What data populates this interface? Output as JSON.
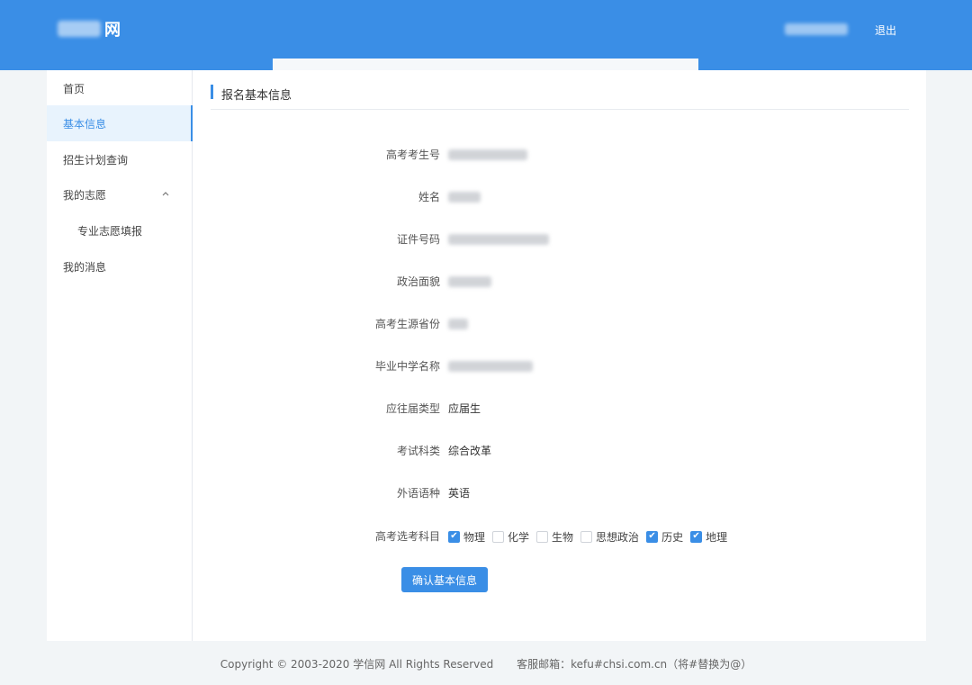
{
  "header": {
    "logo_text": "网",
    "logout_label": "退出"
  },
  "sidebar": {
    "items": [
      {
        "label": "首页"
      },
      {
        "label": "基本信息"
      },
      {
        "label": "招生计划查询"
      },
      {
        "label": "我的志愿"
      },
      {
        "label": "专业志愿填报"
      },
      {
        "label": "我的消息"
      }
    ],
    "expand_icon": "chevron-up-icon"
  },
  "section": {
    "title": "报名基本信息"
  },
  "form": {
    "fields": [
      {
        "label": "高考考生号",
        "value": ""
      },
      {
        "label": "姓名",
        "value": ""
      },
      {
        "label": "证件号码",
        "value": ""
      },
      {
        "label": "政治面貌",
        "value": ""
      },
      {
        "label": "高考生源省份",
        "value": ""
      },
      {
        "label": "毕业中学名称",
        "value": ""
      },
      {
        "label": "应往届类型",
        "value": "应届生"
      },
      {
        "label": "考试科类",
        "value": "综合改革"
      },
      {
        "label": "外语语种",
        "value": "英语"
      }
    ],
    "subjects_label": "高考选考科目",
    "subjects": [
      {
        "label": "物理",
        "checked": true
      },
      {
        "label": "化学",
        "checked": false
      },
      {
        "label": "生物",
        "checked": false
      },
      {
        "label": "思想政治",
        "checked": false
      },
      {
        "label": "历史",
        "checked": true
      },
      {
        "label": "地理",
        "checked": true
      }
    ],
    "confirm_label": "确认基本信息"
  },
  "footer": {
    "copyright": "Copyright © 2003-2020 学信网 All Rights Reserved",
    "service": "客服邮箱：kefu#chsi.com.cn（将#替换为@）"
  },
  "colors": {
    "brand": "#3a8ee6",
    "active_bg": "#e8f3fd"
  }
}
